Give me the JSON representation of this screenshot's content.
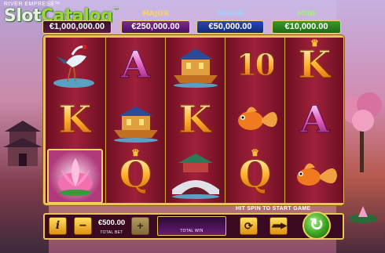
{
  "game_title": "RIVER EMPRESS™",
  "watermark": {
    "slot": "Slot",
    "catalog": "Catalog",
    "tm": "™"
  },
  "jackpots": {
    "grand": {
      "label": "",
      "value": "€1,000,000.00"
    },
    "major": {
      "label": "MAJOR",
      "value": "€250,000.00"
    },
    "minor": {
      "label": "MINOR",
      "value": "€50,000.00"
    },
    "mini": {
      "label": "MINI",
      "value": "€10,000.00"
    }
  },
  "reels": [
    [
      "crane",
      "K",
      "lotus"
    ],
    [
      "A",
      "boat",
      "Q"
    ],
    [
      "boat",
      "K",
      "bridge"
    ],
    [
      "10",
      "goldfish",
      "Q"
    ],
    [
      "K",
      "A",
      "goldfish"
    ]
  ],
  "symbol_text": {
    "K": "K",
    "A": "A",
    "Q": "Q",
    "ten": "10"
  },
  "hint": "HIT SPIN TO START GAME",
  "controls": {
    "info": "i",
    "minus": "−",
    "plus": "+",
    "bet_value": "€500.00",
    "bet_label": "TOTAL BET",
    "win_value": "",
    "win_label": "TOTAL WIN"
  },
  "icons": [
    "info-icon",
    "minus-icon",
    "plus-icon",
    "autoplay-icon",
    "turbo-icon",
    "spin-icon"
  ],
  "colors": {
    "frame_gold": "#e9c25a",
    "reel_red": "#a0203a",
    "spin_green": "#3aa020"
  }
}
